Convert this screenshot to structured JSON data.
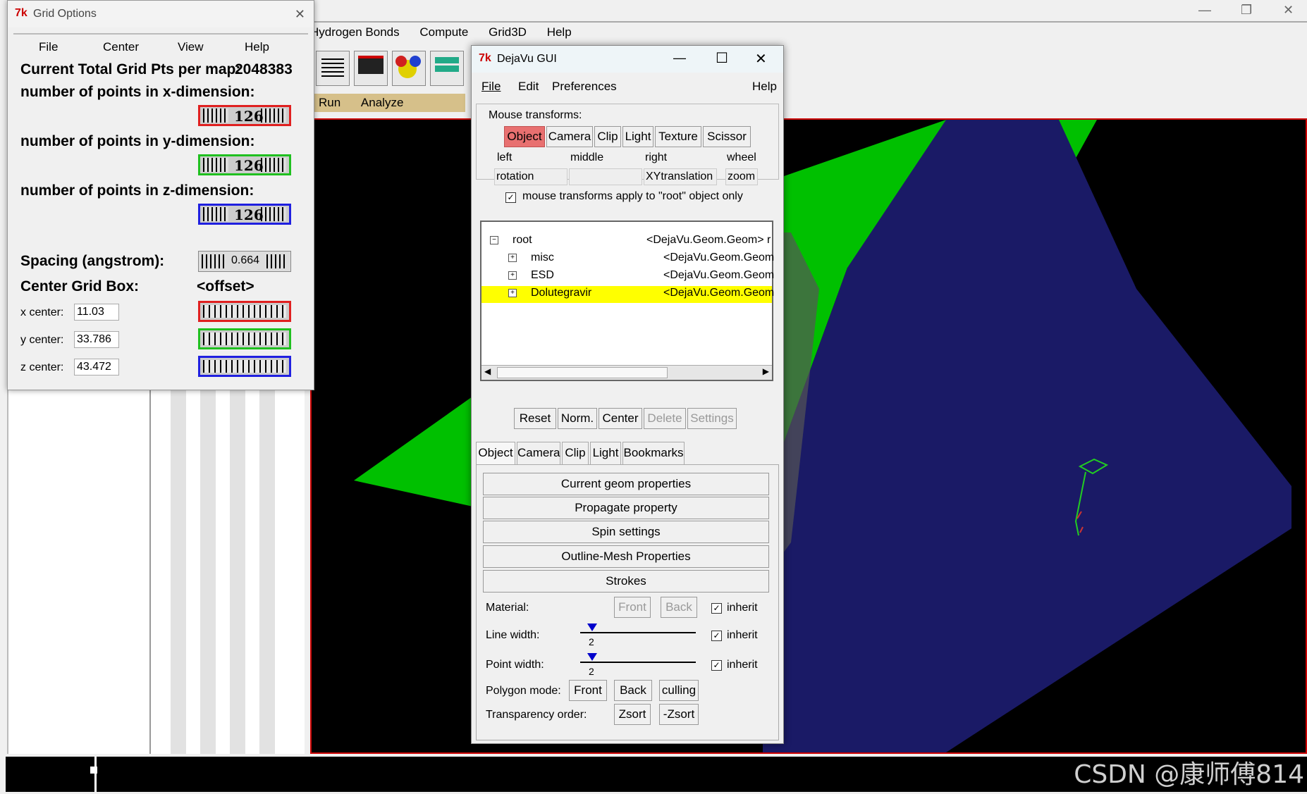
{
  "main": {
    "menus": [
      "Hydrogen Bonds",
      "Compute",
      "Grid3D",
      "Help"
    ],
    "tabs": [
      "Run",
      "Analyze"
    ],
    "win_controls": [
      "—",
      "❐",
      "✕"
    ],
    "watermark": "CSDN @康师傅814"
  },
  "grid": {
    "title": "Grid Options",
    "menus": [
      "File",
      "Center",
      "View",
      "Help"
    ],
    "total_label": "Current Total Grid Pts per map:",
    "total_value": "2048383",
    "x_label": "number of points in x-dimension:",
    "y_label": "number of points in y-dimension:",
    "z_label": "number of points in z-dimension:",
    "x_points": "126",
    "y_points": "126",
    "z_points": "126",
    "spacing_label": "Spacing (angstrom):",
    "spacing_value": "0.664",
    "center_label": "Center Grid Box:",
    "offset_label": "<offset>",
    "x_center_label": "x center:",
    "y_center_label": "y center:",
    "z_center_label": "z center:",
    "x_center": "11.03",
    "y_center": "33.786",
    "z_center": "43.472",
    "close": "✕",
    "colors": {
      "x": "#e02020",
      "y": "#20c020",
      "z": "#2020e0"
    }
  },
  "dv": {
    "title": "DejaVu GUI",
    "menus": [
      "File",
      "Edit",
      "Preferences"
    ],
    "help": "Help",
    "min": "—",
    "max": "☐",
    "close": "✕",
    "mt_label": "Mouse transforms:",
    "mt_tabs": [
      "Object",
      "Camera",
      "Clip",
      "Light",
      "Texture",
      "Scissor"
    ],
    "mb_labels": [
      "left",
      "middle",
      "right",
      "wheel"
    ],
    "mb_values": [
      "rotation",
      "",
      "XYtranslation",
      "zoom"
    ],
    "root_only": "mouse transforms apply to \"root\" object only",
    "tree": [
      {
        "name": "root",
        "type": "<DejaVu.Geom.Geom> r",
        "sign": "−"
      },
      {
        "name": "misc",
        "type": "<DejaVu.Geom.Geom",
        "sign": "+"
      },
      {
        "name": "ESD",
        "type": "<DejaVu.Geom.Geom",
        "sign": "+"
      },
      {
        "name": "Dolutegravir",
        "type": "<DejaVu.Geom.Geom",
        "sign": "+"
      }
    ],
    "actions": [
      "Reset",
      "Norm.",
      "Center",
      "Delete",
      "Settings"
    ],
    "tabs": [
      "Object",
      "Camera",
      "Clip",
      "Light",
      "Bookmarks"
    ],
    "props": [
      "Current geom properties",
      "Propagate property",
      "Spin settings",
      "Outline-Mesh Properties",
      "Strokes"
    ],
    "material_label": "Material:",
    "front": "Front",
    "back": "Back",
    "inherit": "inherit",
    "line_width_label": "Line width:",
    "line_width": "2",
    "point_width_label": "Point width:",
    "point_width": "2",
    "polygon_label": "Polygon mode:",
    "culling": "culling",
    "transp_label": "Transparency order:",
    "zsort": "Zsort",
    "nzsort": "-Zsort",
    "accent": "#e87070",
    "highlight": "#ffff00"
  }
}
